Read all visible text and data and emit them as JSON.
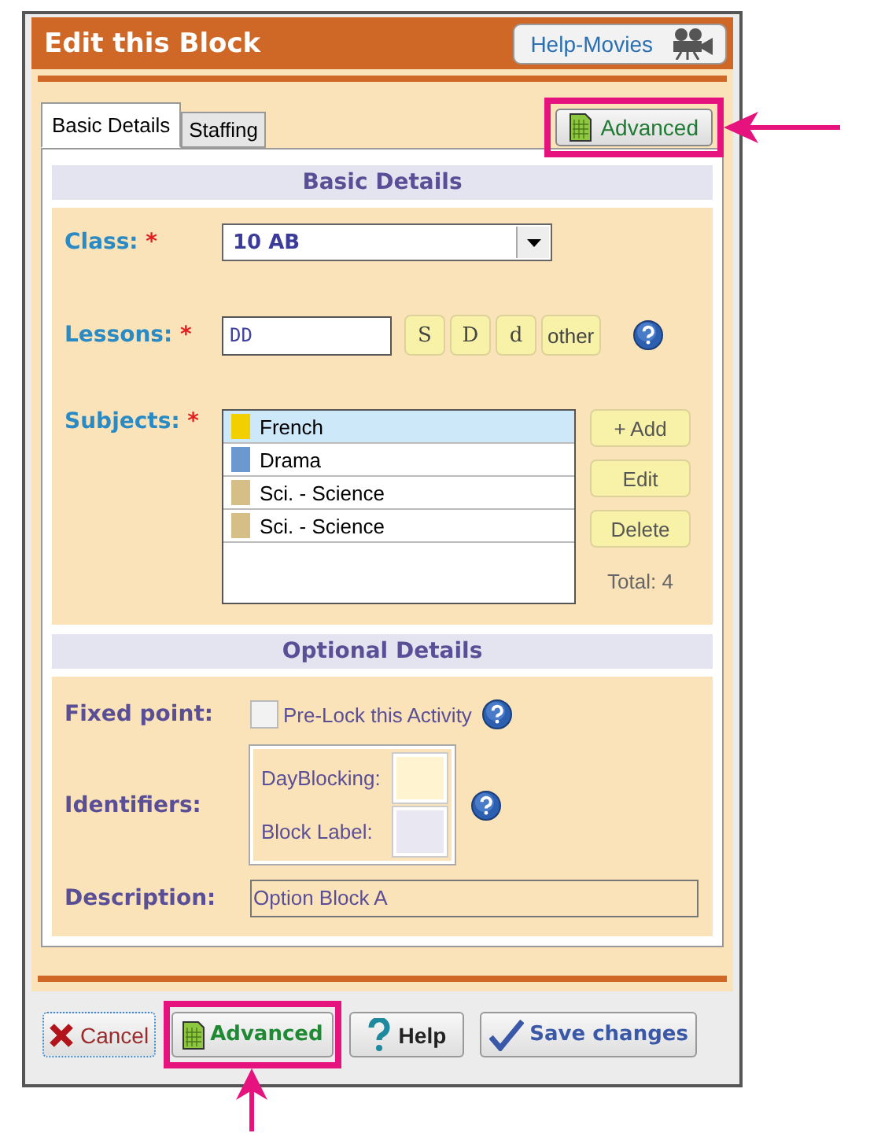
{
  "window": {
    "title": "Edit this Block"
  },
  "help_movies_button": {
    "label": "Help-Movies"
  },
  "tabs": [
    {
      "label": "Basic Details",
      "selected": true
    },
    {
      "label": "Staffing",
      "selected": false
    }
  ],
  "advanced_top_button": {
    "label": "Advanced",
    "highlighted": true
  },
  "basic_section": {
    "heading": "Basic Details",
    "class_field": {
      "label": "Class:",
      "required_mark": "*",
      "value": "10 AB"
    },
    "lessons_field": {
      "label": "Lessons:",
      "required_mark": "*",
      "value": "DD",
      "quick_buttons": [
        "S",
        "D",
        "d",
        "other"
      ]
    },
    "subjects": {
      "label": "Subjects:",
      "required_mark": "*",
      "items": [
        {
          "name": "French",
          "color": "#f2d000",
          "selected": true
        },
        {
          "name": "Drama",
          "color": "#6b98cf",
          "selected": false
        },
        {
          "name": "Sci. - Science",
          "color": "#d6bf86",
          "selected": false
        },
        {
          "name": "Sci. - Science",
          "color": "#d6bf86",
          "selected": false
        }
      ],
      "buttons": [
        "+ Add",
        "Edit",
        "Delete"
      ],
      "total": "Total: 4"
    }
  },
  "optional_section": {
    "heading": "Optional Details",
    "fixed_point": {
      "label": "Fixed point:",
      "checkbox_label": "Pre-Lock this Activity",
      "checked": false
    },
    "identifiers": {
      "label": "Identifiers:",
      "fields": [
        {
          "label": "DayBlocking:",
          "color": "#fff4cf"
        },
        {
          "label": "Block Label:",
          "color": "#e9e8f2"
        }
      ]
    },
    "description": {
      "label": "Description:",
      "value": "Option Block A"
    }
  },
  "footer_buttons": [
    {
      "kind": "cancel",
      "label": "Cancel",
      "highlighted": false
    },
    {
      "kind": "advanced",
      "label": "Advanced",
      "highlighted": true
    },
    {
      "kind": "help",
      "label": "Help",
      "highlighted": false
    },
    {
      "kind": "save",
      "label": "Save changes",
      "highlighted": false
    }
  ]
}
